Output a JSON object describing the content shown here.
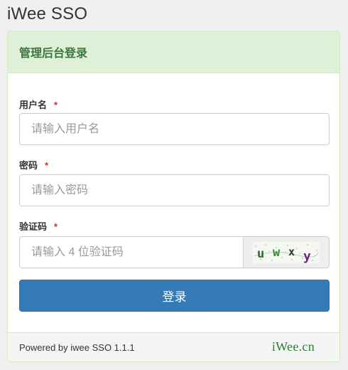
{
  "app": {
    "title": "iWee SSO"
  },
  "panel": {
    "title": "管理后台登录"
  },
  "form": {
    "username": {
      "label": "用户名",
      "required_mark": "*",
      "placeholder": "请输入用户名",
      "value": ""
    },
    "password": {
      "label": "密码",
      "required_mark": "*",
      "placeholder": "请输入密码",
      "value": ""
    },
    "captcha": {
      "label": "验证码",
      "required_mark": "*",
      "placeholder": "请输入 4 位验证码",
      "value": "",
      "image_text": "uwxy"
    },
    "submit_label": "登录"
  },
  "footer": {
    "powered_by": "Powered by iwee SSO 1.1.1",
    "logo_text": "iWee.cn"
  },
  "colors": {
    "primary": "#337ab7",
    "success_bg": "#dff0d8",
    "success_text": "#3c763d",
    "required": "#c9302c",
    "logo": "#2e7d32"
  }
}
